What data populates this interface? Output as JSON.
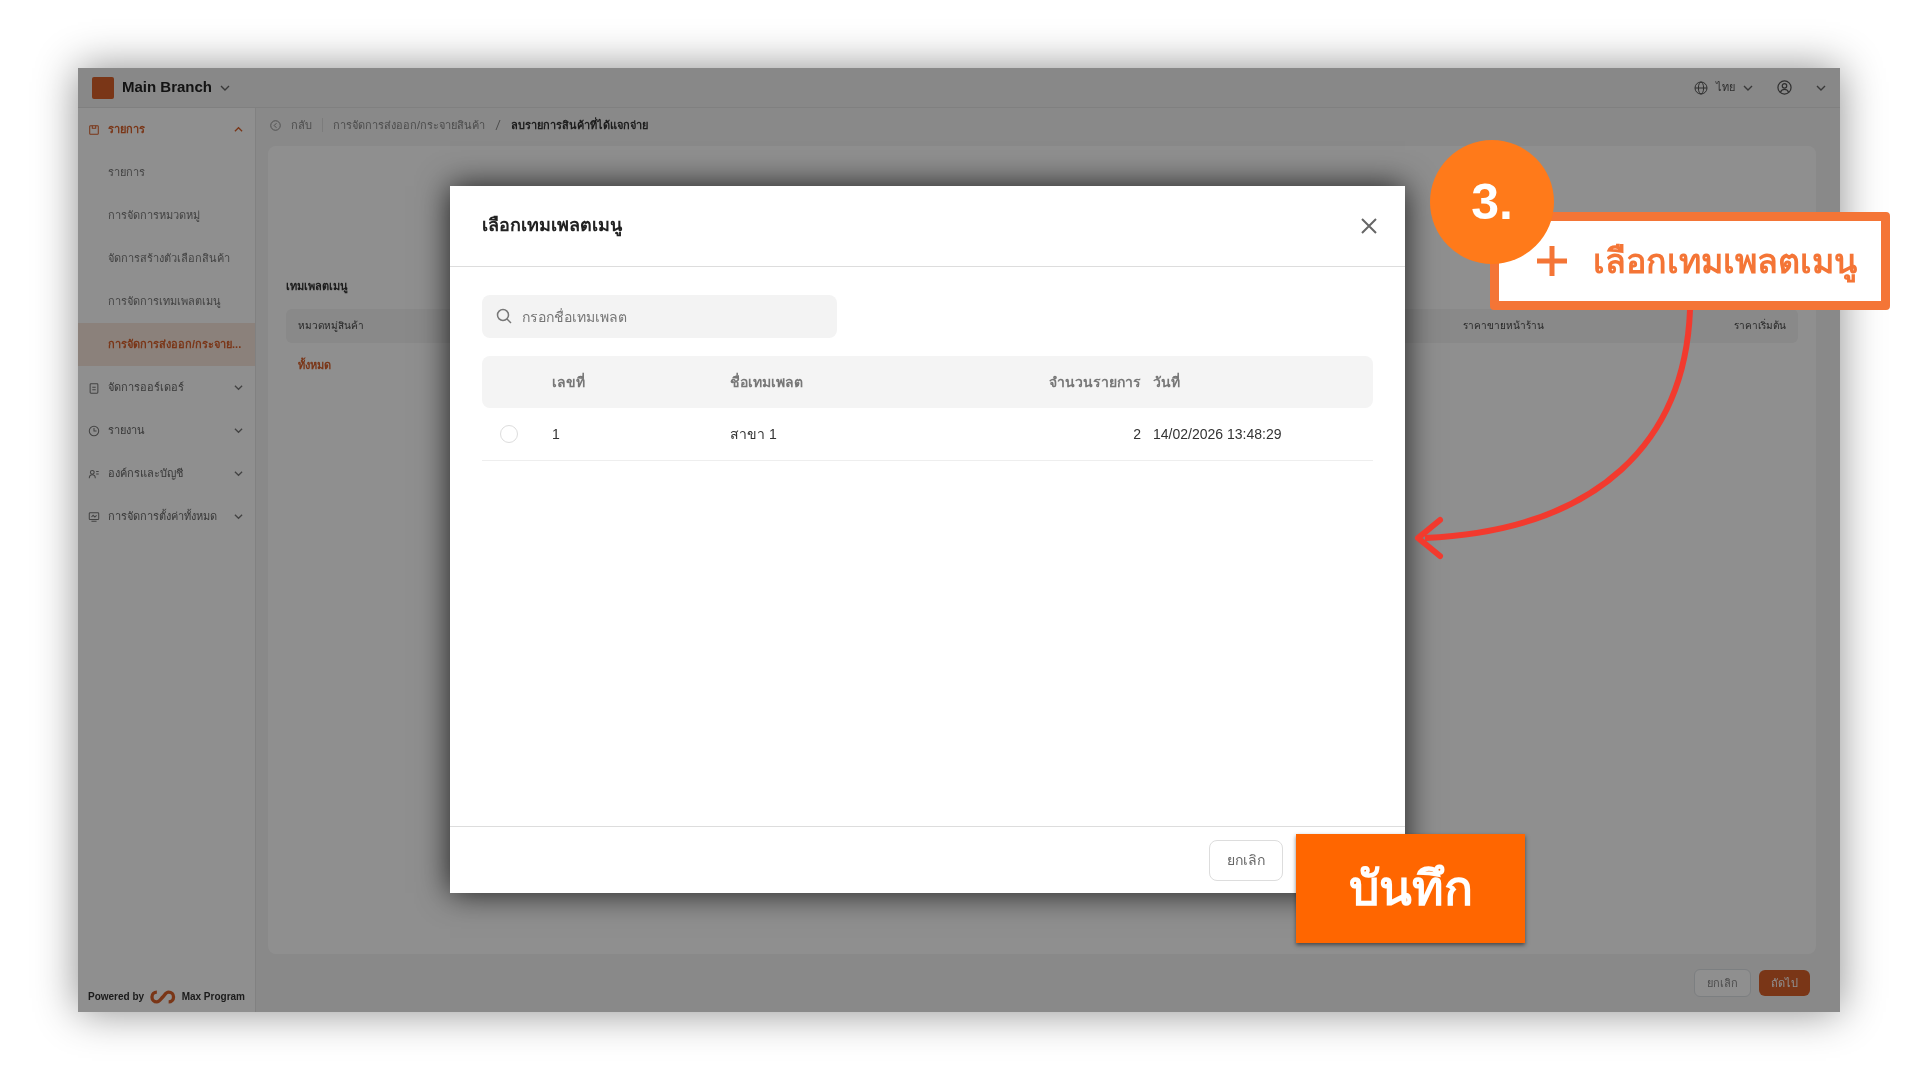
{
  "topbar": {
    "branch": "Main Branch",
    "language": "ไทย"
  },
  "sidebar": {
    "items": [
      {
        "label": "รายการ",
        "expanded": true,
        "selected": true,
        "children": [
          {
            "label": "รายการ",
            "selected": false
          },
          {
            "label": "การจัดการหมวดหมู่",
            "selected": false
          },
          {
            "label": "จัดการสร้างตัวเลือกสินค้า",
            "selected": false
          },
          {
            "label": "การจัดการเทมเพลตเมนู",
            "selected": false
          },
          {
            "label": "การจัดการส่งออก/กระจาย...",
            "selected": true
          }
        ]
      },
      {
        "label": "จัดการออร์เดอร์",
        "expanded": false,
        "selected": false
      },
      {
        "label": "รายงาน",
        "expanded": false,
        "selected": false
      },
      {
        "label": "องค์กรและบัญชี",
        "expanded": false,
        "selected": false
      },
      {
        "label": "การจัดการตั้งค่าทั้งหมด",
        "expanded": false,
        "selected": false
      }
    ],
    "powered_by": "Powered by",
    "brand": "Max Program"
  },
  "breadcrumb": {
    "back": "กลับ",
    "items": [
      "การจัดการส่งออก/กระจายสินค้า",
      "ลบรายการสินค้าที่ได้แจกจ่าย"
    ]
  },
  "page": {
    "section_title": "เทมเพลตเมนู",
    "columns": [
      "หมวดหมู่สินค้า",
      "ราคาขายหน้าร้าน",
      "ราคาเริ่มต้น"
    ],
    "category": "ทั้งหมด",
    "buttons": [
      "ยกเลิก",
      "ถัดไป"
    ]
  },
  "modal": {
    "title": "เลือกเทมเพลตเมนู",
    "search": {
      "placeholder": "กรอกชื่อเทมเพลต"
    },
    "columns": [
      "เลขที่",
      "ชื่อเทมเพลต",
      "จำนวนรายการ",
      "วันที่"
    ],
    "rows": [
      {
        "selected": false,
        "cells": [
          "1",
          "สาขา 1",
          "2",
          "14/02/2026 13:48:29"
        ]
      }
    ],
    "cancel": "ยกเลิก"
  },
  "annotations": {
    "step": "3.",
    "callout": "เลือกเทมเพลตเมนู",
    "save": "บันทึก"
  }
}
